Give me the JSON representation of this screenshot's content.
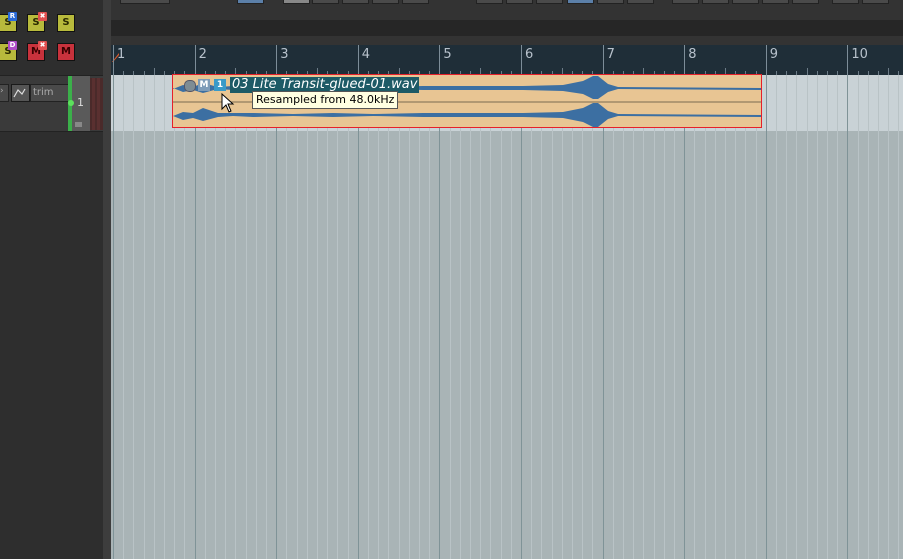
{
  "track": {
    "fx_label": "trim",
    "number": "1"
  },
  "track_controls": {
    "solo_label": "S",
    "mute_label": "M",
    "badge_r": "R",
    "badge_d": "D",
    "badge_x": "✖"
  },
  "ruler": {
    "bars": [
      "1",
      "2",
      "3",
      "4",
      "5",
      "6",
      "7",
      "8",
      "9",
      "10"
    ]
  },
  "item": {
    "name": "03 Lite Transit-glued-01.wav",
    "take_number": "1",
    "mute_flag": "M",
    "tooltip": "Resampled from 48.0kHz"
  },
  "colors": {
    "item_fill": "#e8c593",
    "waveform": "#3c6fa2",
    "item_border": "#e6202a",
    "ruler_bg": "#1f2e38",
    "grid_bg": "#a9b4b6"
  }
}
